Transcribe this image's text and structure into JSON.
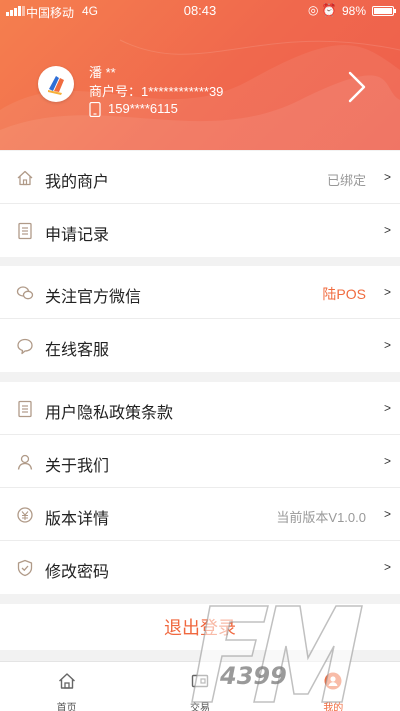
{
  "status_bar": {
    "carrier": "中国移动",
    "network": "4G",
    "time": "08:43",
    "battery_percent": "98%",
    "battery_level": 0.98
  },
  "profile": {
    "name": "潘 **",
    "merchant_no": "商户号：1************39",
    "phone": "159****6115"
  },
  "groups": [
    {
      "items": [
        {
          "label": "我的商户",
          "value": "已绑定",
          "icon": "home-icon"
        },
        {
          "label": "申请记录",
          "value": "",
          "icon": "document-icon"
        }
      ]
    },
    {
      "items": [
        {
          "label": "关注官方微信",
          "value": "陆POS",
          "icon": "wechat-icon"
        },
        {
          "label": "在线客服",
          "value": "",
          "icon": "chat-bubble-icon"
        }
      ]
    },
    {
      "items": [
        {
          "label": "用户隐私政策条款",
          "value": "",
          "icon": "document-icon"
        },
        {
          "label": "关于我们",
          "value": "",
          "icon": "person-icon"
        },
        {
          "label": "版本详情",
          "value": "当前版本V1.0.0",
          "icon": "version-icon"
        },
        {
          "label": "修改密码",
          "value": "",
          "icon": "shield-icon"
        }
      ]
    }
  ],
  "chevron": ">",
  "logout_label": "退出登录",
  "tabs": [
    {
      "label": "首页",
      "icon": "home-icon"
    },
    {
      "label": "交易",
      "icon": "wallet-icon"
    },
    {
      "label": "我的",
      "icon": "profile-icon"
    }
  ],
  "watermark": {
    "text": "4399"
  },
  "colors": {
    "accent": "#f06b3f",
    "header_start": "#f57f4e",
    "header_end": "#ee5f4c"
  }
}
